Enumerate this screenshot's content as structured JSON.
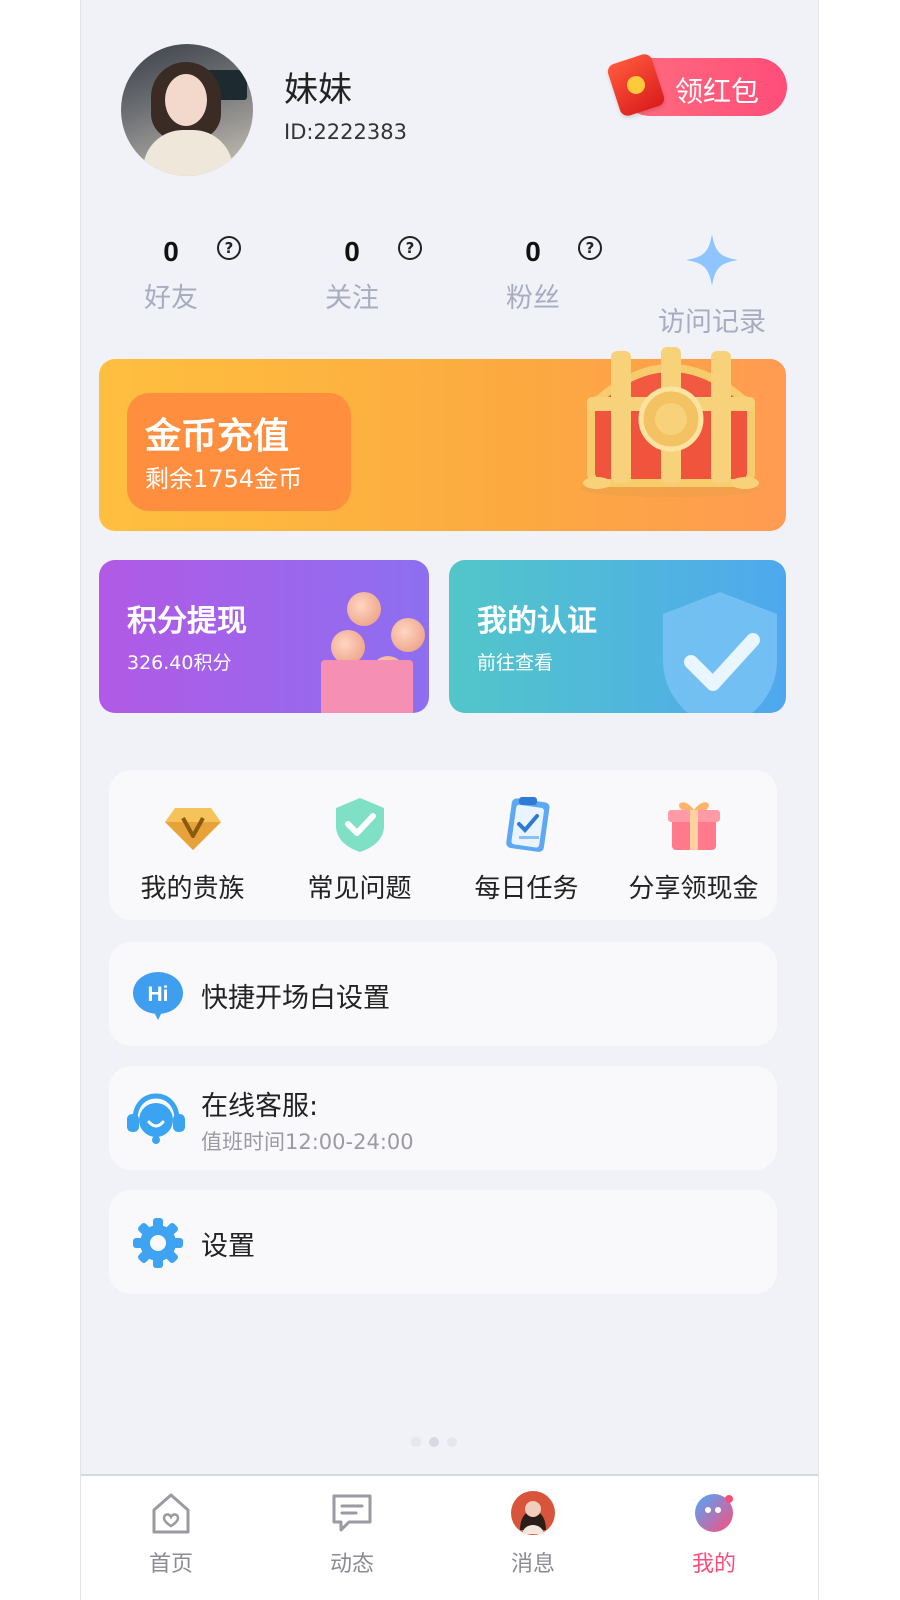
{
  "profile": {
    "nickname": "妹妹",
    "id_text": "ID:2222383",
    "red_packet_label": "领红包"
  },
  "stats": [
    {
      "count": "0",
      "label": "好友"
    },
    {
      "count": "0",
      "label": "关注"
    },
    {
      "count": "0",
      "label": "粉丝"
    }
  ],
  "help_icon_glyph": "?",
  "visit_label": "访问记录",
  "coin_card": {
    "title": "金币充值",
    "subtitle": "剩余1754金币"
  },
  "points_card": {
    "title": "积分提现",
    "subtitle": "326.40积分"
  },
  "cert_card": {
    "title": "我的认证",
    "subtitle": "前往查看"
  },
  "grid": [
    {
      "label": "我的贵族",
      "icon": "diamond-icon"
    },
    {
      "label": "常见问题",
      "icon": "shield-check-icon"
    },
    {
      "label": "每日任务",
      "icon": "clipboard-icon"
    },
    {
      "label": "分享领现金",
      "icon": "gift-icon"
    }
  ],
  "rows": {
    "greeting": {
      "title": "快捷开场白设置",
      "icon_text": "Hi"
    },
    "service": {
      "title": "在线客服:",
      "subtitle": "值班时间12:00-24:00"
    },
    "settings": {
      "title": "设置"
    }
  },
  "tabbar": [
    {
      "label": "首页",
      "icon": "home-icon"
    },
    {
      "label": "动态",
      "icon": "message-square-icon"
    },
    {
      "label": "消息",
      "icon": "avatar-icon"
    },
    {
      "label": "我的",
      "icon": "profile-icon",
      "active": true
    }
  ],
  "colors": {
    "accent": "#ff4d7a",
    "background": "#f1f2f7",
    "coin_card": "#fcaa40",
    "points_card": "#9b67ec",
    "cert_card": "#4fb6e0"
  }
}
